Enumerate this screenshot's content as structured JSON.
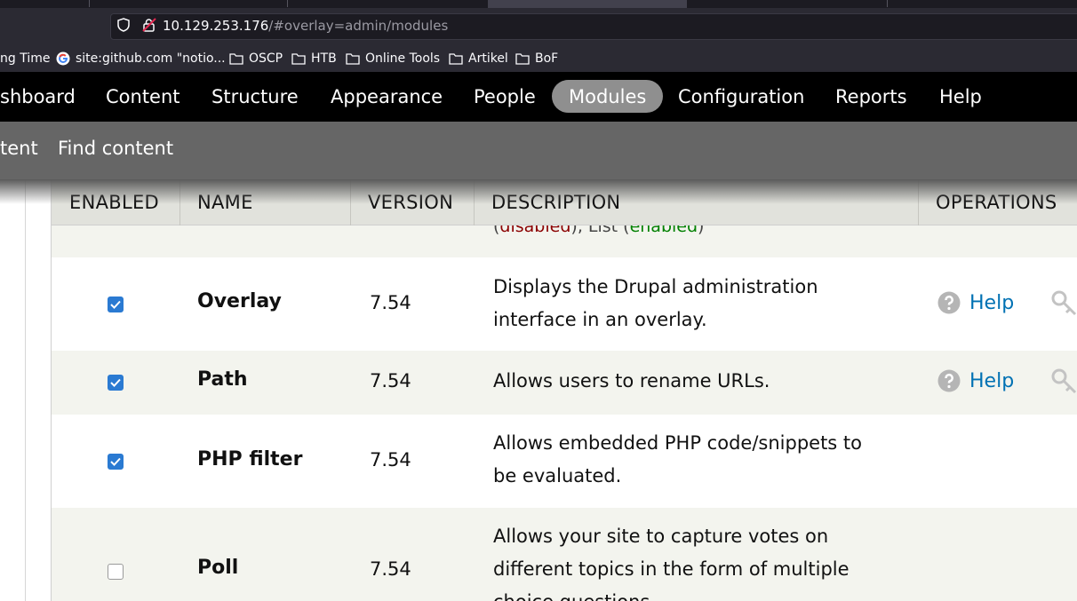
{
  "browser": {
    "url_host": "10.129.253.176",
    "url_path": "/#overlay=admin/modules",
    "bookmarks": [
      {
        "label": "ng Time",
        "icon": "none"
      },
      {
        "label": "site:github.com \"notio...",
        "icon": "google-icon"
      },
      {
        "label": "OSCP",
        "icon": "folder-icon"
      },
      {
        "label": "HTB",
        "icon": "folder-icon"
      },
      {
        "label": "Online Tools",
        "icon": "folder-icon"
      },
      {
        "label": "Artikel",
        "icon": "folder-icon"
      },
      {
        "label": "BoF",
        "icon": "folder-icon"
      }
    ]
  },
  "toolbar": {
    "items": [
      "shboard",
      "Content",
      "Structure",
      "Appearance",
      "People",
      "Modules",
      "Configuration",
      "Reports",
      "Help"
    ],
    "active": "Modules"
  },
  "shortcuts": {
    "items": [
      "tent",
      "Find content"
    ]
  },
  "table": {
    "headers": {
      "enabled": "ENABLED",
      "name": "NAME",
      "version": "VERSION",
      "description": "DESCRIPTION",
      "operations": "OPERATIONS"
    },
    "partial_row": {
      "open": "(",
      "disabled": "disabled",
      "mid": "), List (",
      "enabled": "enabled",
      "close": ")"
    },
    "rows": [
      {
        "enabled": true,
        "name": "Overlay",
        "version": "7.54",
        "description_lines": [
          "Displays the Drupal administration",
          "interface in an overlay."
        ],
        "help": "Help"
      },
      {
        "enabled": true,
        "name": "Path",
        "version": "7.54",
        "description_lines": [
          "Allows users to rename URLs."
        ],
        "help": "Help"
      },
      {
        "enabled": true,
        "name": "PHP filter",
        "version": "7.54",
        "description_lines": [
          "Allows embedded PHP code/snippets to",
          "be evaluated."
        ],
        "help": ""
      },
      {
        "enabled": false,
        "name": "Poll",
        "version": "7.54",
        "description_lines": [
          "Allows your site to capture votes on",
          "different topics in the form of multiple",
          "choice questions."
        ],
        "help": ""
      }
    ]
  },
  "colors": {
    "toolbar_bg": "#000000",
    "shortcut_bg": "#666666",
    "active_tab": "#8f8f8f",
    "header_bg": "#e1e2dc",
    "row_even": "#f3f4ee",
    "link": "#0071b3",
    "checkbox": "#2a7ad2"
  }
}
